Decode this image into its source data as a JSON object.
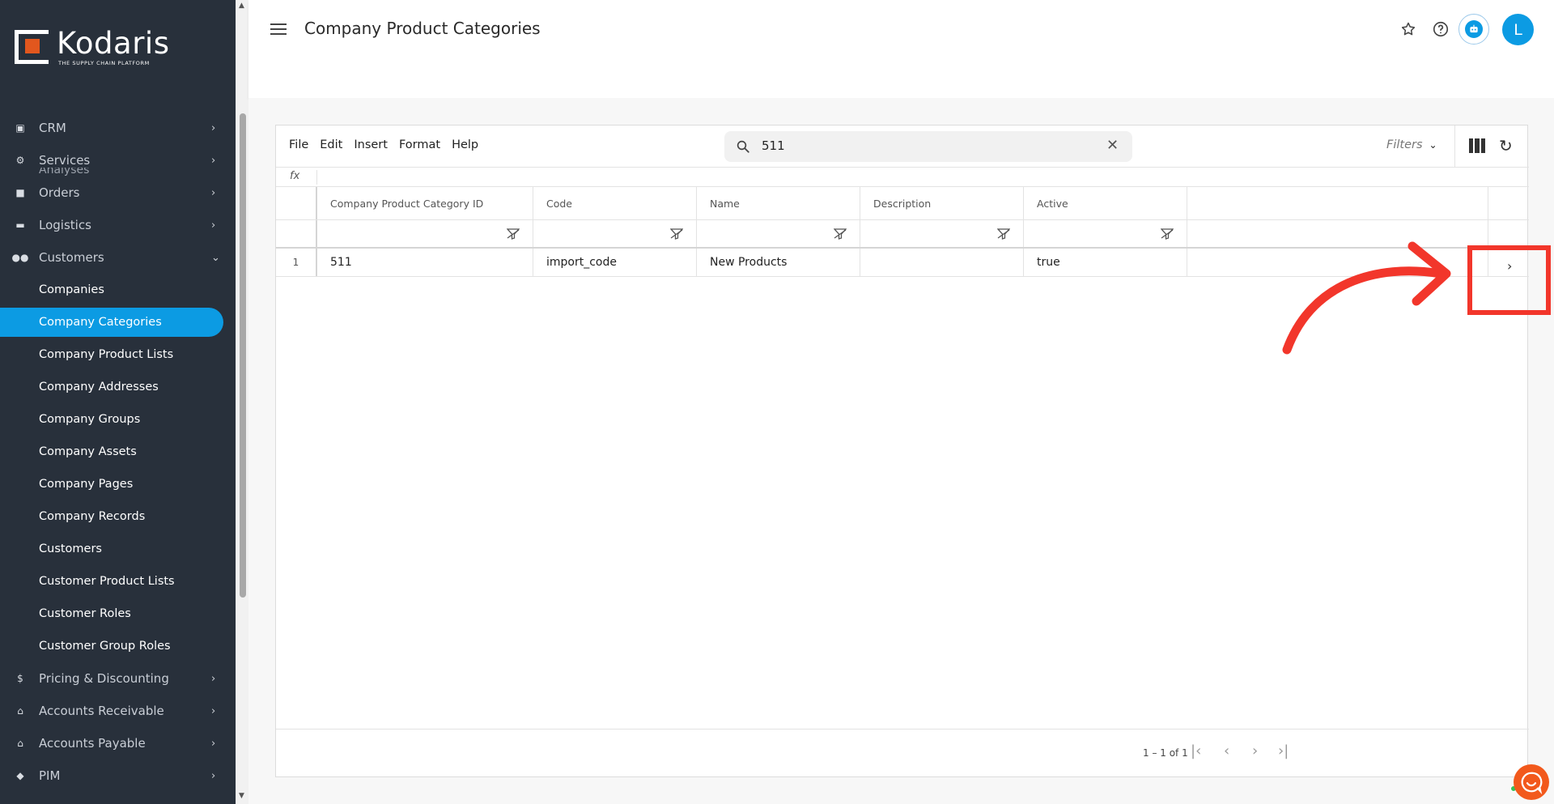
{
  "brand": {
    "name": "Kodaris",
    "tagline": "THE SUPPLY CHAIN PLATFORM",
    "accent": "#0c9be3",
    "logo_orange": "#e2571e",
    "sidebar_bg": "#28303b"
  },
  "sidebar": {
    "partial_top": "Analyses",
    "items": [
      {
        "label": "CRM",
        "icon": "id-card-icon"
      },
      {
        "label": "Services",
        "icon": "gears-icon"
      },
      {
        "label": "Orders",
        "icon": "truck-icon"
      },
      {
        "label": "Logistics",
        "icon": "delivery-truck-icon"
      },
      {
        "label": "Customers",
        "icon": "users-icon",
        "expanded": true
      },
      {
        "label": "Pricing & Discounting",
        "icon": "dollar-icon"
      },
      {
        "label": "Accounts Receivable",
        "icon": "bank-icon"
      },
      {
        "label": "Accounts Payable",
        "icon": "bank-icon"
      },
      {
        "label": "PIM",
        "icon": "tag-icon"
      }
    ],
    "customers_sub": [
      "Companies",
      "Company Categories",
      "Company Product Lists",
      "Company Addresses",
      "Company Groups",
      "Company Assets",
      "Company Pages",
      "Company Records",
      "Customers",
      "Customer Product Lists",
      "Customer Roles",
      "Customer Group Roles"
    ],
    "active_sub": "Company Categories"
  },
  "header": {
    "title": "Company Product Categories",
    "avatar_initial": "L"
  },
  "toolbar": {
    "menu": [
      "File",
      "Edit",
      "Insert",
      "Format",
      "Help"
    ],
    "search_value": "511",
    "filters_label": "Filters"
  },
  "formula_bar": {
    "label": "fx"
  },
  "table": {
    "columns": [
      "Company Product Category ID",
      "Code",
      "Name",
      "Description",
      "Active"
    ],
    "rows": [
      {
        "num": "1",
        "cells": [
          "511",
          "import_code",
          "New Products",
          "",
          "true"
        ]
      }
    ]
  },
  "pagination": {
    "range_text": "1 – 1 of 1"
  },
  "annotation": {
    "color": "#f2362b"
  }
}
